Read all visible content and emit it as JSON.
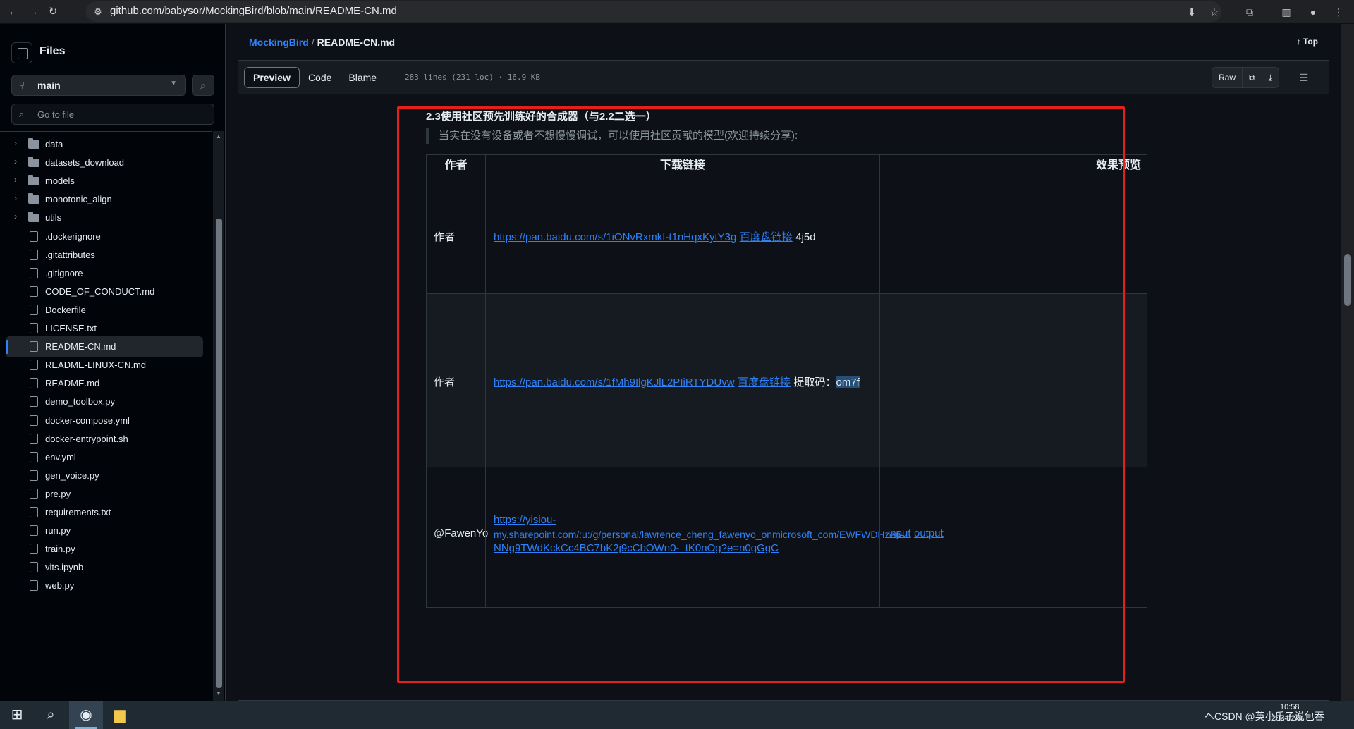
{
  "browser": {
    "url": "github.com/babysor/MockingBird/blob/main/README-CN.md",
    "nav": [
      "back-icon",
      "forward-icon",
      "reload-icon",
      "site-info-icon"
    ],
    "actions": [
      "install-icon",
      "bookmark-star-icon",
      "extensions-icon",
      "side-panel-icon",
      "profile-icon"
    ]
  },
  "sidebar": {
    "title": "Files",
    "branch": "main",
    "goto_placeholder": "Go to file",
    "tree": [
      {
        "type": "folder",
        "label": "data"
      },
      {
        "type": "folder",
        "label": "datasets_download"
      },
      {
        "type": "folder",
        "label": "models"
      },
      {
        "type": "folder",
        "label": "monotonic_align"
      },
      {
        "type": "folder",
        "label": "utils"
      },
      {
        "type": "file",
        "label": ".dockerignore"
      },
      {
        "type": "file",
        "label": ".gitattributes"
      },
      {
        "type": "file",
        "label": ".gitignore"
      },
      {
        "type": "file",
        "label": "CODE_OF_CONDUCT.md"
      },
      {
        "type": "file",
        "label": "Dockerfile"
      },
      {
        "type": "file",
        "label": "LICENSE.txt"
      },
      {
        "type": "file",
        "label": "README-CN.md",
        "active": true
      },
      {
        "type": "file",
        "label": "README-LINUX-CN.md"
      },
      {
        "type": "file",
        "label": "README.md"
      },
      {
        "type": "file",
        "label": "demo_toolbox.py"
      },
      {
        "type": "file",
        "label": "docker-compose.yml"
      },
      {
        "type": "file",
        "label": "docker-entrypoint.sh"
      },
      {
        "type": "file",
        "label": "env.yml"
      },
      {
        "type": "file",
        "label": "gen_voice.py"
      },
      {
        "type": "file",
        "label": "pre.py"
      },
      {
        "type": "file",
        "label": "requirements.txt"
      },
      {
        "type": "file",
        "label": "run.py"
      },
      {
        "type": "file",
        "label": "train.py"
      },
      {
        "type": "file",
        "label": "vits.ipynb"
      },
      {
        "type": "file",
        "label": "web.py"
      }
    ]
  },
  "file_header": {
    "repo": "MockingBird",
    "separator": "/",
    "file": "README-CN.md",
    "top_label": "Top"
  },
  "toolbar": {
    "tabs": [
      "Preview",
      "Code",
      "Blame"
    ],
    "active_tab": "Preview",
    "meta": "283 lines (231 loc) · 16.9 KB",
    "raw_label": "Raw"
  },
  "content": {
    "heading": "2.3使用社区预先训练好的合成器（与2.2二选一）",
    "quote": "当实在没有设备或者不想慢慢调试，可以使用社区贡献的模型(欢迎持续分享):",
    "table": {
      "headers": [
        "作者",
        "下载链接",
        "效果预览"
      ],
      "rows": [
        {
          "author": "作者",
          "link": "https://pan.baidu.com/s/1iONvRxmkI-t1nHqxKytY3g",
          "link2": "百度盘链接",
          "suffix": "4j5d",
          "preview": []
        },
        {
          "author": "作者",
          "link": "https://pan.baidu.com/s/1fMh9IlgKJlL2PIiRTYDUvw",
          "link2": "百度盘链接",
          "suffix_label": "提取码：",
          "suffix_highlight": "om7f",
          "preview": []
        },
        {
          "author": "@FawenYo",
          "link_lines": [
            "https://yisiou-",
            "my.sharepoint.com/:u:/g/personal/lawrence_cheng_fawenyo_onmicrosoft_com/EWFWDHzee-",
            "NNg9TWdKckCc4BC7bK2j9cCbOWn0-_tK0nOg?e=n0gGgC"
          ],
          "preview": [
            "input",
            "output"
          ]
        }
      ]
    }
  },
  "taskbar": {
    "items": [
      "windows-start-icon",
      "search-icon",
      "chrome-icon",
      "file-explorer-icon"
    ],
    "tray": "ヘCSDN @英小乐子说包吞",
    "time": "10:58",
    "date": "2024/2/5"
  },
  "colors": {
    "accent_link": "#2f81f7",
    "annotation_box": "#e5201c",
    "bg": "#0d1117"
  }
}
